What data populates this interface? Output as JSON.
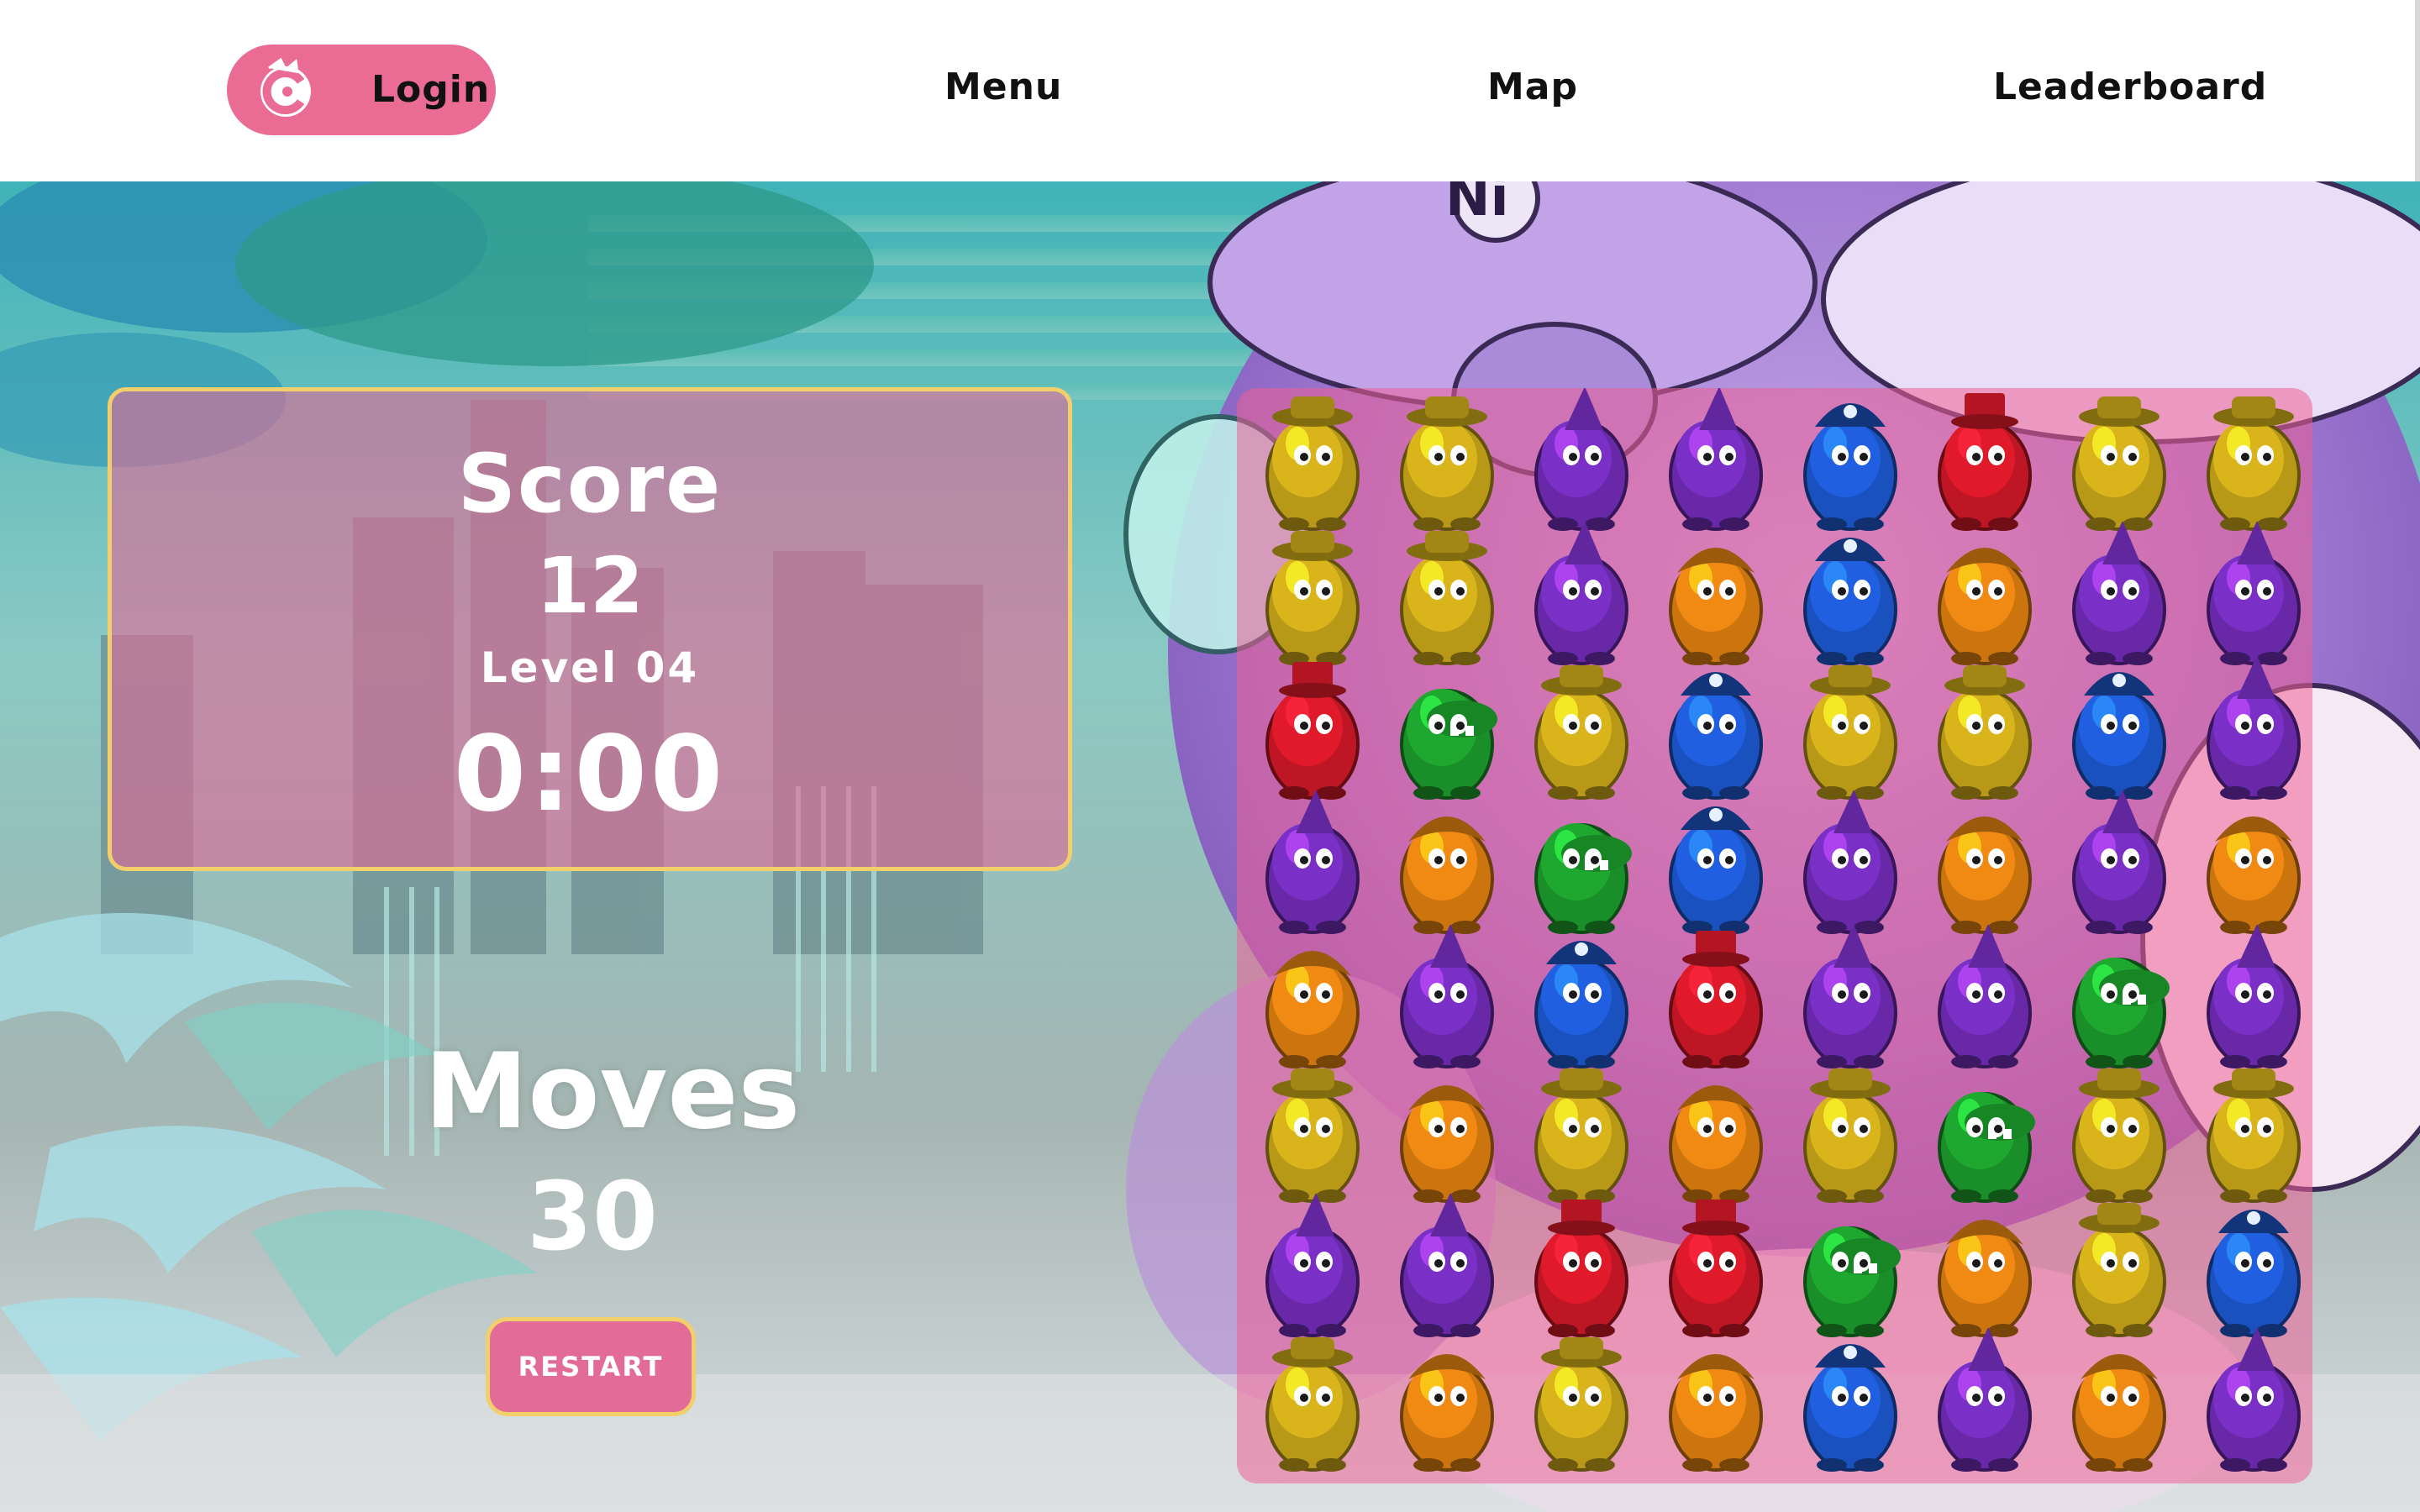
{
  "nav": {
    "login_label": "Login",
    "menu_label": "Menu",
    "map_label": "Map",
    "leaderboard_label": "Leaderboard"
  },
  "icons": {
    "login_logo": "game-logo-icon"
  },
  "game": {
    "score_label": "Score",
    "score": "12",
    "level_label": "Level 04",
    "timer": "0:00",
    "moves_label": "Moves",
    "moves": "30",
    "restart_label": "RESTART"
  },
  "colors": {
    "accent": "#ea6b94",
    "panel_border": "#f2cf6a",
    "yellow": "#d9b41b",
    "purple": "#7a2fc6",
    "blue": "#1f5fe0",
    "red": "#e01a2a",
    "orange": "#f08a12",
    "green": "#1fa830"
  },
  "board": {
    "columns": 8,
    "rows": 8,
    "pieces": [
      [
        "yellow",
        "yellow",
        "purple",
        "purple",
        "blue",
        "red",
        "yellow",
        "yellow"
      ],
      [
        "yellow",
        "yellow",
        "purple",
        "orange",
        "blue",
        "orange",
        "purple",
        "purple"
      ],
      [
        "red",
        "green",
        "yellow",
        "blue",
        "yellow",
        "yellow",
        "blue",
        "purple"
      ],
      [
        "purple",
        "orange",
        "green",
        "blue",
        "purple",
        "orange",
        "purple",
        "orange"
      ],
      [
        "orange",
        "purple",
        "blue",
        "red",
        "purple",
        "purple",
        "green",
        "purple"
      ],
      [
        "yellow",
        "orange",
        "yellow",
        "orange",
        "yellow",
        "green",
        "yellow",
        "yellow"
      ],
      [
        "purple",
        "purple",
        "red",
        "red",
        "green",
        "orange",
        "yellow",
        "blue"
      ],
      [
        "yellow",
        "orange",
        "yellow",
        "orange",
        "blue",
        "purple",
        "orange",
        "purple"
      ]
    ]
  }
}
